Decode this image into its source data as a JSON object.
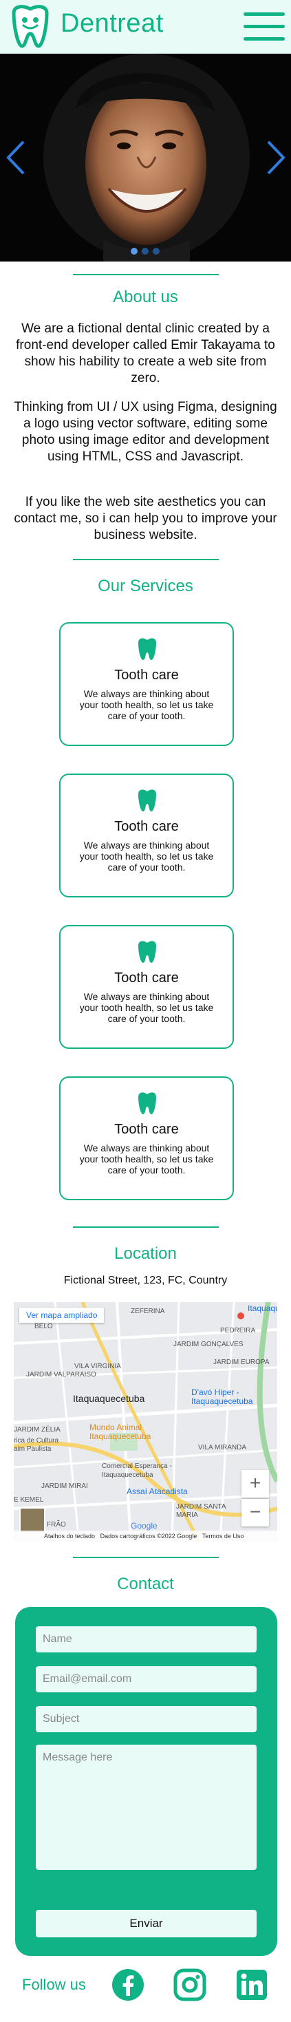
{
  "header": {
    "brand": "Dentreat",
    "menu_icon": "hamburger-menu-icon",
    "logo_icon": "smiling-tooth-logo-icon"
  },
  "hero": {
    "slide_description_icon": "smiling-man-photo",
    "prev_icon": "chevron-left-icon",
    "next_icon": "chevron-right-icon",
    "slide_count": 3,
    "active_slide": 1
  },
  "about": {
    "title": "About us",
    "paragraphs": [
      "We are a fictional dental clinic created by a front-end developer called Emir Takayama to show his hability to create a web site from zero.",
      "Thinking from UI / UX using Figma, designing a logo using vector software, editing some photo using image editor and development using HTML, CSS and Javascript.",
      "If you like the web site aesthetics you can contact me, so i can help you to improve your business website."
    ]
  },
  "services": {
    "title": "Our Services",
    "items": [
      {
        "icon": "tooth-icon",
        "title": "Tooth care",
        "text": "We always are thinking about your tooth health, so let us take care of your tooth."
      },
      {
        "icon": "tooth-icon",
        "title": "Tooth care",
        "text": "We always are thinking about your tooth health, so let us take care of your tooth."
      },
      {
        "icon": "tooth-icon",
        "title": "Tooth care",
        "text": "We always are thinking about your tooth health, so let us take care of your tooth."
      },
      {
        "icon": "tooth-icon",
        "title": "Tooth care",
        "text": "We always are thinking about your tooth health, so let us take care of your tooth."
      }
    ]
  },
  "location": {
    "title": "Location",
    "address": "Fictional Street, 123, FC, Country",
    "map": {
      "view_larger": "Ver mapa ampliado",
      "zoom_in": "+",
      "zoom_out": "−",
      "labels": {
        "itaquaquec": "Itaquaquec",
        "zeferina": "ZEFERINA",
        "belo": "BELO",
        "pedreira": "PEDREIRA",
        "jardim_goncalves": "JARDIM GONÇALVES",
        "jardim_europa": "JARDIM EUROPA",
        "jardim_valparaiso": "JARDIM VALPARAISO",
        "vila_virginia": "VILA VIRGINIA",
        "itaquaquecetuba": "Itaquaquecetuba",
        "davo": "D'avó Hiper - Itaquaquecetuba",
        "jardim_zelia": "JARDIM ZÉLIA",
        "mundo_animal": "Mundo Animal Itaquaquecetuba",
        "casa_cultura": "rica de Cultura aim Paulista",
        "vila_miranda": "VILA MIRANDA",
        "comercial": "Comercial Esperança - Itaquaquecetuba",
        "jardim_mirai": "JARDIM MIRAI",
        "assai": "Assaí Atacadista",
        "kemel": "E KEMEL",
        "jardim_santa_maria": "JARDIM SANTA MARIA",
        "frao": "FRÃO",
        "google": "Google"
      },
      "footer": {
        "shortcuts": "Atalhos do teclado",
        "data": "Dados cartográficos ©2022 Google",
        "terms": "Termos de Uso"
      }
    }
  },
  "contact": {
    "title": "Contact",
    "name_placeholder": "Name",
    "email_placeholder": "Email@email.com",
    "subject_placeholder": "Subject",
    "message_placeholder": "Message here",
    "send_label": "Enviar"
  },
  "footer": {
    "follow_label": "Follow us",
    "social": [
      "facebook-icon",
      "instagram-icon",
      "linkedin-icon"
    ]
  },
  "colors": {
    "accent": "#10b385",
    "light": "#e8fbf7",
    "hero_bg": "#050505"
  }
}
